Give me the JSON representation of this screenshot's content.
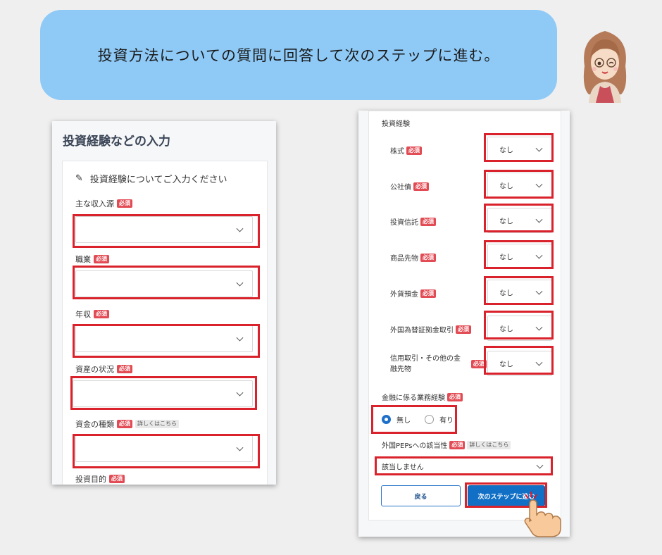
{
  "banner": {
    "text": "投資方法についての質問に回答して次のステップに進む。"
  },
  "left_panel": {
    "title": "投資経験などの入力",
    "card_header": "投資経験についてご入力ください",
    "fields": [
      {
        "label": "主な収入源",
        "required": "必須"
      },
      {
        "label": "職業",
        "required": "必須"
      },
      {
        "label": "年収",
        "required": "必須"
      },
      {
        "label": "資産の状況",
        "required": "必須"
      },
      {
        "label": "資金の種類",
        "required": "必須",
        "more": "詳しくはこちら"
      },
      {
        "label": "投資目的",
        "required": "必須"
      }
    ]
  },
  "right_panel": {
    "section_title": "投資経験",
    "rows": [
      {
        "label": "株式",
        "required": "必須",
        "value": "なし"
      },
      {
        "label": "公社債",
        "required": "必須",
        "value": "なし"
      },
      {
        "label": "投資信託",
        "required": "必須",
        "value": "なし"
      },
      {
        "label": "商品先物",
        "required": "必須",
        "value": "なし"
      },
      {
        "label": "外貨預金",
        "required": "必須",
        "value": "なし"
      },
      {
        "label": "外国為替証拠金取引",
        "required": "必須",
        "value": "なし"
      },
      {
        "label_line1": "信用取引・その他の金",
        "label_line2": "融先物",
        "required": "必須",
        "value": "なし"
      }
    ],
    "finance_label": "金融に係る業務経験",
    "finance_required": "必須",
    "radio_options": [
      "無し",
      "有り"
    ],
    "radio_selected": "無し",
    "peps_label": "外国PEPsへの該当性",
    "peps_required": "必須",
    "peps_more": "詳しくはこちら",
    "peps_value": "該当しません",
    "back_button": "戻る",
    "next_button": "次のステップに進む"
  },
  "colors": {
    "banner": "#8fcaf7",
    "highlight": "#d9222b",
    "required_badge": "#e24b54",
    "primary_button": "#1170c6"
  }
}
